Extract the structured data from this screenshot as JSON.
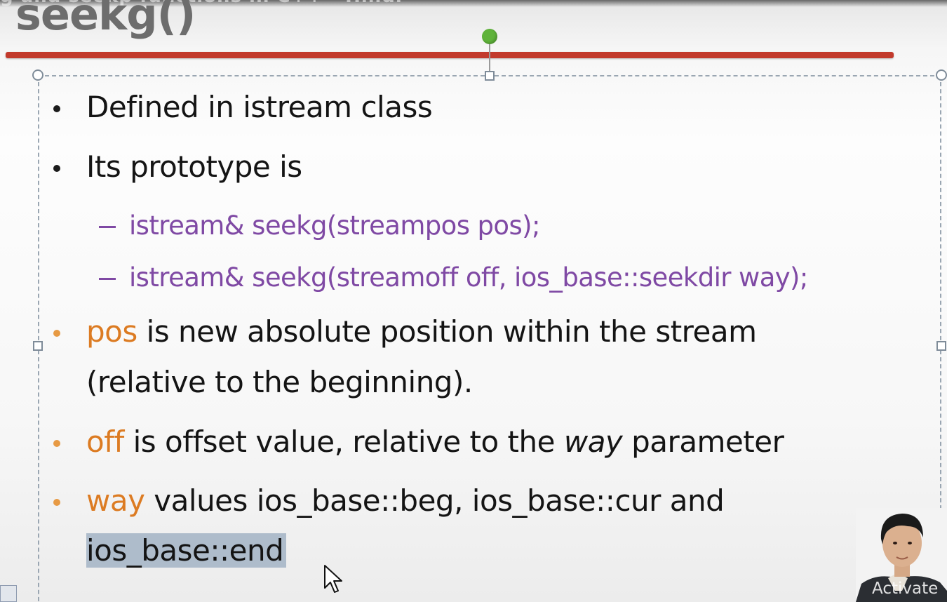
{
  "video": {
    "title": "g and seekp functions in C++ - Hindi"
  },
  "slide": {
    "title": "seekg()",
    "bullets": {
      "b1": "Defined in istream class",
      "b2": "Its prototype is",
      "sub1": "istream& seekg(streampos pos);",
      "sub2": "istream& seekg(streamoff off, ios_base::seekdir way);",
      "b3_keyword": "pos",
      "b3_text": " is new absolute position within the stream",
      "b3_line2": "(relative to the beginning).",
      "b4_keyword": "off",
      "b4_text_before": " is offset value, relative to the ",
      "b4_emph": "way",
      "b4_text_after": " parameter",
      "b5_keyword": "way",
      "b5_text": " values ios_base::beg, ios_base::cur and",
      "b5_line2": "ios_base::end"
    }
  },
  "overlay": {
    "watermark": "Activate"
  },
  "colors": {
    "title_rule": "#c23a2c",
    "keyword": "#dc7b22",
    "sub_bullet": "#7f49a4",
    "selection_highlight": "#aebccb"
  },
  "icons": {
    "rotation_handle": "green-circle",
    "cursor": "arrow-pointer-icon"
  }
}
